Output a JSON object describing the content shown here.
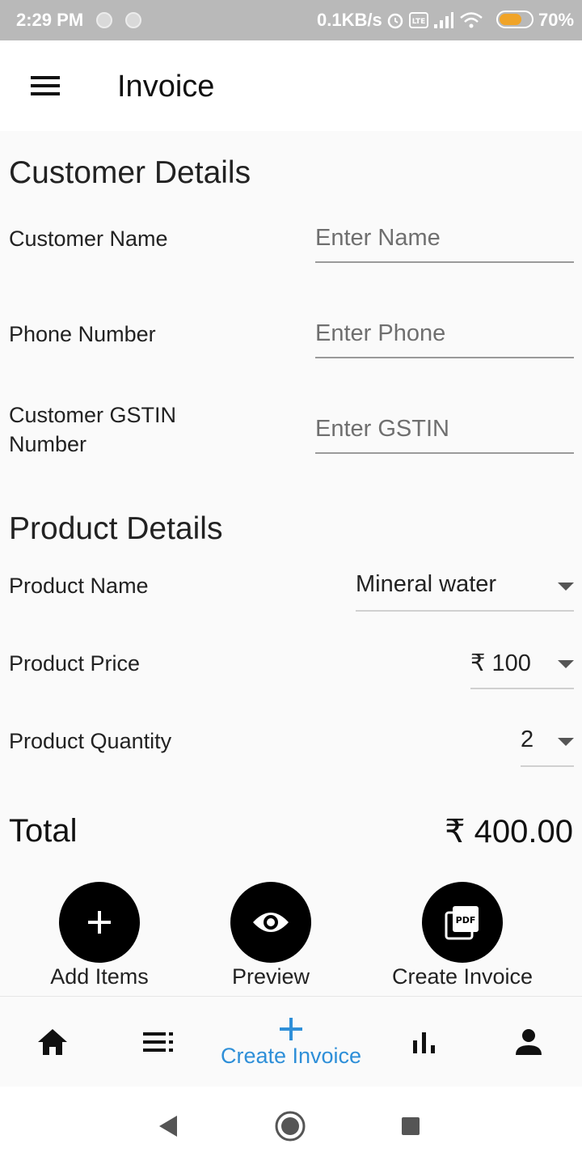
{
  "status_bar": {
    "time": "2:29 PM",
    "speed": "0.1KB/s",
    "battery": "70%",
    "battery_level": 0.7,
    "icons": [
      "alarm-icon",
      "volte-icon",
      "signal-icon",
      "wifi-icon",
      "battery-icon"
    ]
  },
  "app_bar": {
    "title": "Invoice",
    "menu_icon": "menu-icon"
  },
  "customer": {
    "section_title": "Customer Details",
    "name_label": "Customer Name",
    "name_placeholder": "Enter Name",
    "name_value": "",
    "phone_label": "Phone Number",
    "phone_placeholder": "Enter Phone",
    "phone_value": "",
    "gstin_label_line1": "Customer GSTIN",
    "gstin_label_line2": "Number",
    "gstin_placeholder": "Enter GSTIN",
    "gstin_value": ""
  },
  "product": {
    "section_title": "Product Details",
    "name_label": "Product Name",
    "name_value": "Mineral water",
    "price_label": "Product Price",
    "price_value": "₹ 100",
    "quantity_label": "Product Quantity",
    "quantity_value": "2"
  },
  "total": {
    "label": "Total",
    "value": "₹ 400.00"
  },
  "actions": [
    {
      "label": "Add Items",
      "icon": "plus-icon"
    },
    {
      "label": "Preview",
      "icon": "eye-icon"
    },
    {
      "label": "Create Invoice",
      "icon": "pdf-icon"
    }
  ],
  "bottom_nav": {
    "items": [
      {
        "icon": "home-icon",
        "label": ""
      },
      {
        "icon": "list-icon",
        "label": ""
      },
      {
        "icon": "plus-icon",
        "label": "Create Invoice",
        "active": true
      },
      {
        "icon": "bar-chart-icon",
        "label": ""
      },
      {
        "icon": "person-icon",
        "label": ""
      }
    ],
    "active_color": "#2e8fd8"
  },
  "system_nav": [
    "back-icon",
    "home-circle-icon",
    "recents-icon"
  ]
}
